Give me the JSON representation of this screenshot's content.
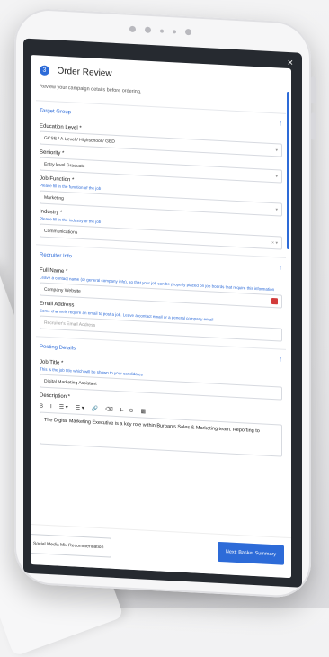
{
  "modal": {
    "close_symbol": "×",
    "step_number": "3",
    "title": "Order Review",
    "subtitle": "Review your campaign details before ordering."
  },
  "target_group": {
    "title": "Target Group",
    "collapse_icon": "arrow-up-icon",
    "education": {
      "label": "Education Level *",
      "value": "GCSE / A-Level / Highschool / GED"
    },
    "seniority": {
      "label": "Seniority *",
      "value": "Entry level Graduate"
    },
    "job_function": {
      "label": "Job Function *",
      "hint": "Please fill in the function of the job",
      "value": "Marketing"
    },
    "industry": {
      "label": "Industry *",
      "hint": "Please fill in the industry of the job",
      "value": "Communications"
    }
  },
  "recruiter_info": {
    "title": "Recruiter Info",
    "full_name": {
      "label": "Full Name *",
      "hint": "Leave a contact name (or general company info), so that your job can be properly placed on job boards that require this information",
      "value": "Company Website"
    },
    "email": {
      "label": "Email Address",
      "hint": "Some channels require an email to post a job. Leave a contact email or a general company email",
      "placeholder": "Recruiter's Email Address"
    }
  },
  "posting_details": {
    "title": "Posting Details",
    "job_title": {
      "label": "Job Title *",
      "hint": "This is the job title which will be shown to your candidates",
      "value": "Digital Marketing Assistant"
    },
    "description": {
      "label": "Description *",
      "toolbar": [
        "B",
        "I",
        "☰ ▾",
        "☰ ▾",
        "🔗",
        "⌫",
        "I̶",
        "⊙",
        "▦"
      ],
      "text": "The Digital Marketing Executive is a key role within Burban's Sales & Marketing team. Reporting to"
    }
  },
  "footer": {
    "back_label": "Social Media Mix Recommendation",
    "next_label": "Next: Basket Summary"
  },
  "colors": {
    "accent": "#2d6bd8",
    "dark_bg": "#262a30"
  }
}
